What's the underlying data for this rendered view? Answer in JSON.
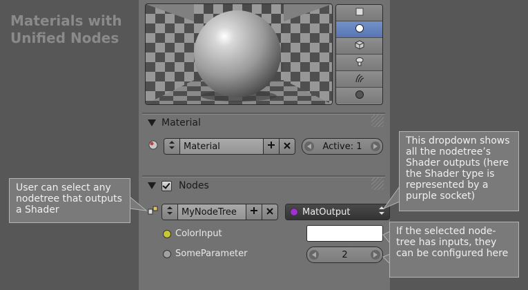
{
  "heading": {
    "line1": "Materials with",
    "line2": "Unified Nodes"
  },
  "preview_buttons": [
    {
      "icon": "flat-icon",
      "active": false
    },
    {
      "icon": "sphere-icon",
      "active": true
    },
    {
      "icon": "cube-icon",
      "active": false
    },
    {
      "icon": "monkey-icon",
      "active": false
    },
    {
      "icon": "hair-icon",
      "active": false
    },
    {
      "icon": "sky-sphere-icon",
      "active": false
    }
  ],
  "material_section": {
    "header": "Material",
    "name_value": "Material",
    "active_label": "Active: 1"
  },
  "nodes_section": {
    "header": "Nodes",
    "nodetree_value": "MyNodeTree",
    "output_value": "MatOutput",
    "inputs": [
      {
        "label": "ColorInput",
        "socket_color": "#c8c832"
      },
      {
        "label": "SomeParameter",
        "socket_color": "#a0a0a0"
      }
    ],
    "some_parameter_value": "2"
  },
  "colors": {
    "accent": "#5675b3",
    "shader_socket": "#a030d0"
  },
  "callouts": {
    "left": "User can select any nodetree that outputs a Shader",
    "top_right": "This dropdown shows all the nodetree’s Shader outputs (here the Shader type is represented by a purple socket)",
    "bottom_right": "If the selected node-tree has inputs, they can be configured here"
  }
}
